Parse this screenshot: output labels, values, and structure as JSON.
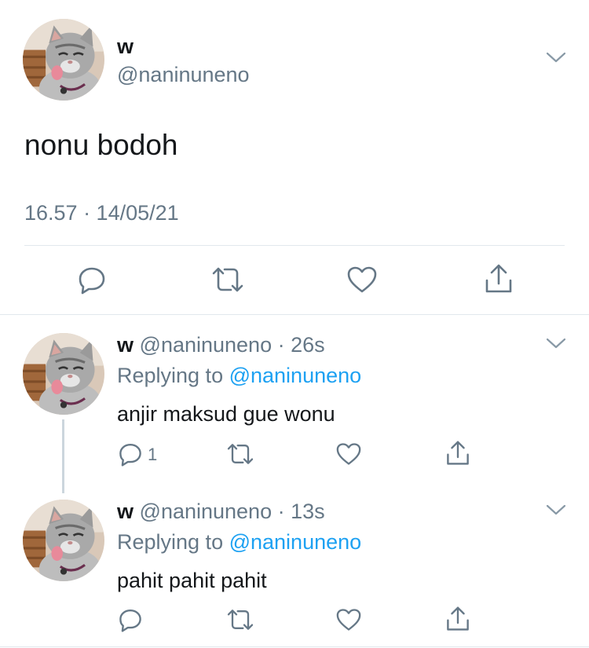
{
  "main_tweet": {
    "name": "w",
    "handle": "@naninuneno",
    "text": "nonu bodoh",
    "timestamp": "16.57 · 14/05/21"
  },
  "replies": [
    {
      "name": "w",
      "handle": "@naninuneno",
      "sep": " · ",
      "time": "26s",
      "replying_label": "Replying to ",
      "replying_to": "@naninuneno",
      "text": "anjir maksud gue wonu",
      "reply_count": "1"
    },
    {
      "name": "w",
      "handle": "@naninuneno",
      "sep": " · ",
      "time": "13s",
      "replying_label": "Replying to ",
      "replying_to": "@naninuneno",
      "text": "pahit pahit pahit",
      "reply_count": ""
    }
  ],
  "icons": {
    "reply": "reply-icon",
    "retweet": "retweet-icon",
    "like": "heart-icon",
    "share": "share-icon",
    "more": "chevron-down-icon"
  },
  "colors": {
    "text": "#14171a",
    "secondary": "#657786",
    "mention": "#1da1f2",
    "divider": "#e1e8ed"
  }
}
